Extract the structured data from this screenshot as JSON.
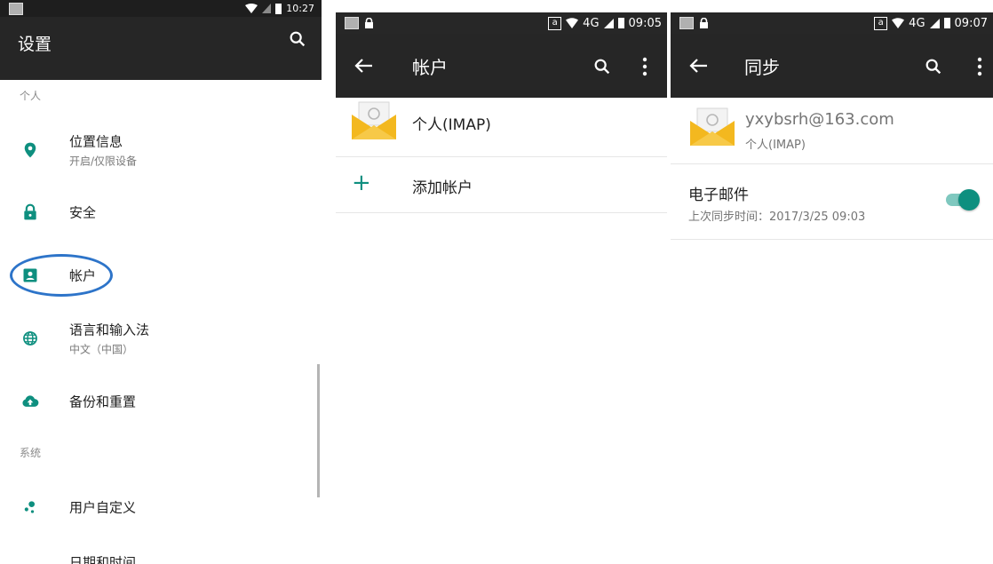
{
  "colors": {
    "toolbar": "#262626",
    "accent": "#0e8f7f",
    "highlight": "#2d74c9"
  },
  "settings_screen": {
    "status": {
      "time": "10:27"
    },
    "title": "设置",
    "section_personal": "个人",
    "items": [
      {
        "label": "位置信息",
        "sub": "开启/仅限设备",
        "icon": "location-pin-icon"
      },
      {
        "label": "安全",
        "icon": "lock-icon"
      },
      {
        "label": "帐户",
        "icon": "account-box-icon"
      },
      {
        "label": "语言和输入法",
        "sub": "中文（中国）",
        "icon": "globe-icon"
      },
      {
        "label": "备份和重置",
        "icon": "cloud-upload-icon"
      }
    ],
    "section_system": "系统",
    "system_items": [
      {
        "label": "用户自定义",
        "icon": "customize-icon"
      },
      {
        "label": "日期和时间",
        "icon": "clock-icon"
      }
    ]
  },
  "accounts_screen": {
    "status": {
      "a_label": "a",
      "network": "4G",
      "time": "09:05"
    },
    "title": "帐户",
    "account_label": "个人(IMAP)",
    "add_label": "添加帐户"
  },
  "sync_screen": {
    "status": {
      "a_label": "a",
      "network": "4G",
      "time": "09:07"
    },
    "title": "同步",
    "email": "yxybsrh@163.com",
    "account_type": "个人(IMAP)",
    "item_label": "电子邮件",
    "item_sub": "上次同步时间：2017/3/25 09:03",
    "toggle_on": true
  }
}
